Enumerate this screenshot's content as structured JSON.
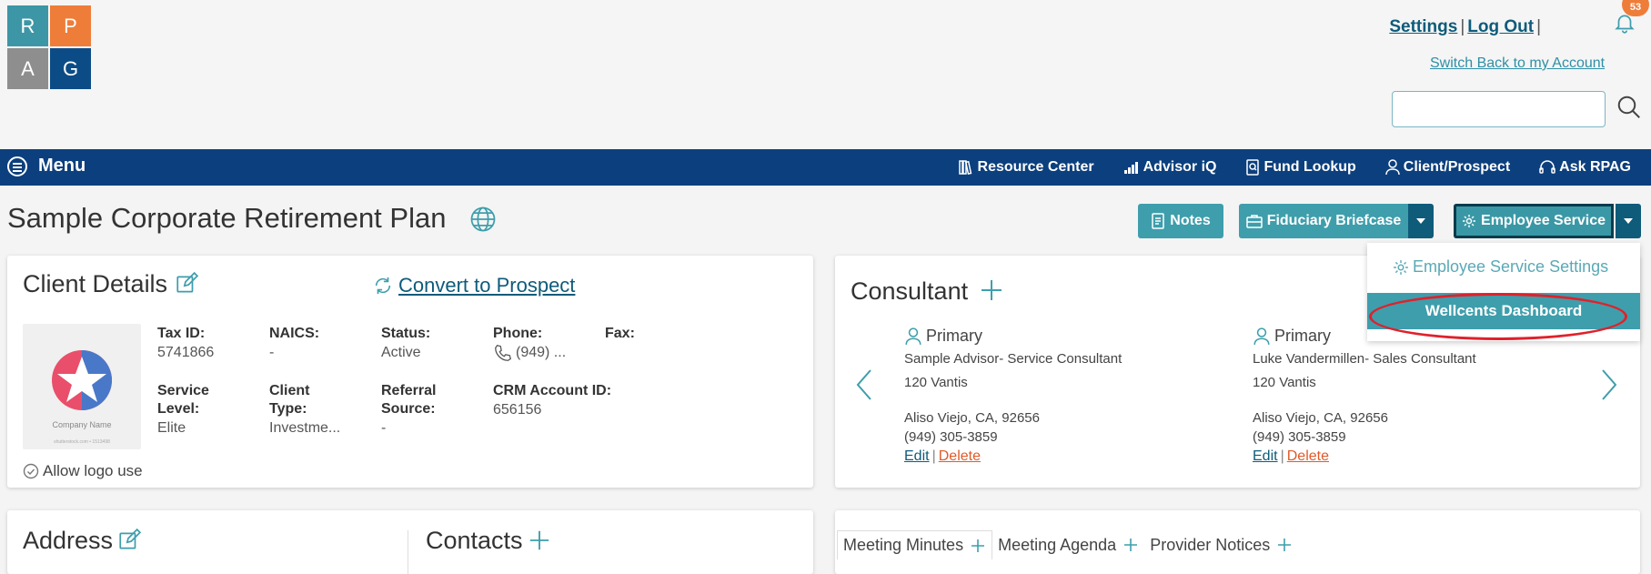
{
  "logo": {
    "letters": [
      "R",
      "P",
      "A",
      "G"
    ]
  },
  "top_links": {
    "settings": "Settings",
    "logout": "Log Out",
    "separator": "|",
    "switch_account": "Switch Back to my Account"
  },
  "notifications": {
    "count": "53"
  },
  "search": {
    "value": "",
    "placeholder": ""
  },
  "menubar": {
    "menu_label": "Menu",
    "nav": [
      {
        "label": "Resource Center",
        "icon": "books-icon"
      },
      {
        "label": "Advisor iQ",
        "icon": "signal-bars-icon"
      },
      {
        "label": "Fund Lookup",
        "icon": "document-search-icon"
      },
      {
        "label": "Client/Prospect",
        "icon": "person-icon"
      },
      {
        "label": "Ask RPAG",
        "icon": "headset-icon"
      }
    ]
  },
  "page": {
    "title": "Sample Corporate Retirement Plan"
  },
  "toolbar": {
    "notes": "Notes",
    "fiduciary_briefcase": "Fiduciary Briefcase",
    "employee_service": "Employee Service"
  },
  "employee_service_menu": {
    "items": [
      "Employee Service Settings",
      "Wellcents Dashboard"
    ],
    "highlight_color": "#e0212b"
  },
  "client_details": {
    "title": "Client Details",
    "convert_link": "Convert to Prospect",
    "logo_caption": "Company Name",
    "logo_fineprint": "shutterstock.com • 1513498",
    "allow_logo": "Allow logo use",
    "fields": [
      {
        "label": "Tax ID:",
        "value": "5741866"
      },
      {
        "label": "NAICS:",
        "value": "-"
      },
      {
        "label": "Status:",
        "value": "Active"
      },
      {
        "label": "Phone:",
        "value": "(949) ..."
      },
      {
        "label": "Fax:",
        "value": ""
      },
      {
        "label": "Service Level:",
        "value": "Elite"
      },
      {
        "label": "Client Type:",
        "value": "Investme..."
      },
      {
        "label": "Referral Source:",
        "value": "-"
      },
      {
        "label": "CRM Account ID:",
        "value": "656156"
      }
    ]
  },
  "consultant": {
    "title": "Consultant",
    "cards": [
      {
        "role": "Primary",
        "name": "Sample Advisor- Service Consultant",
        "address1": "120 Vantis",
        "address2": "Aliso Viejo, CA, 92656",
        "phone": "(949) 305-3859",
        "edit": "Edit",
        "delete": "Delete"
      },
      {
        "role": "Primary",
        "name": "Luke Vandermillen- Sales Consultant",
        "address1": "120 Vantis",
        "address2": "Aliso Viejo, CA, 92656",
        "phone": "(949) 305-3859",
        "edit": "Edit",
        "delete": "Delete"
      }
    ]
  },
  "address": {
    "title": "Address"
  },
  "contacts": {
    "title": "Contacts"
  },
  "meetings": {
    "tabs": [
      "Meeting Minutes",
      "Meeting Agenda",
      "Provider Notices"
    ]
  },
  "colors": {
    "navy": "#0c3f7d",
    "teal": "#3e9eac",
    "orange": "#ef7d3a",
    "link": "#0e5b7a"
  }
}
